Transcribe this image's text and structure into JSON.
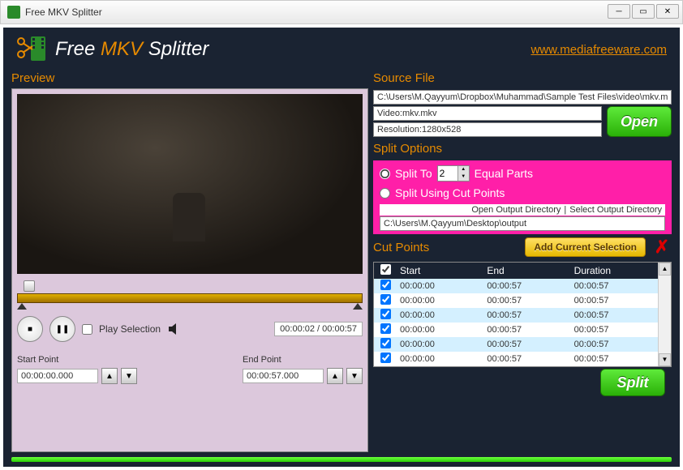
{
  "window": {
    "title": "Free MKV Splitter"
  },
  "header": {
    "logo_pre": "Free ",
    "logo_mid": "MKV",
    "logo_post": " Splitter",
    "link": "www.mediafreeware.com"
  },
  "preview": {
    "title": "Preview",
    "play_selection_label": "Play Selection",
    "time_current": "00:00:02",
    "time_sep": " / ",
    "time_total": "00:00:57",
    "start_label": "Start Point",
    "start_value": "00:00:00.000",
    "end_label": "End Point",
    "end_value": "00:00:57.000"
  },
  "source": {
    "title": "Source File",
    "path": "C:\\Users\\M.Qayyum\\Dropbox\\Muhammad\\Sample Test Files\\video\\mkv.m",
    "video": "Video:mkv.mkv",
    "resolution": "Resolution:1280x528",
    "open_label": "Open"
  },
  "split_options": {
    "title": "Split Options",
    "split_to_label": "Split To",
    "split_to_value": "2",
    "equal_parts_label": "Equal Parts",
    "split_cut_label": "Split Using Cut Points",
    "open_out_dir": "Open Output Directory",
    "sep": "  |  ",
    "select_out_dir": "Select Output Directory",
    "out_path": "C:\\Users\\M.Qayyum\\Desktop\\output"
  },
  "cut": {
    "title": "Cut Points",
    "add_label": "Add Current Selection",
    "cols": {
      "start": "Start",
      "end": "End",
      "duration": "Duration"
    },
    "rows": [
      {
        "start": "00:00:00",
        "end": "00:00:57",
        "duration": "00:00:57"
      },
      {
        "start": "00:00:00",
        "end": "00:00:57",
        "duration": "00:00:57"
      },
      {
        "start": "00:00:00",
        "end": "00:00:57",
        "duration": "00:00:57"
      },
      {
        "start": "00:00:00",
        "end": "00:00:57",
        "duration": "00:00:57"
      },
      {
        "start": "00:00:00",
        "end": "00:00:57",
        "duration": "00:00:57"
      },
      {
        "start": "00:00:00",
        "end": "00:00:57",
        "duration": "00:00:57"
      }
    ]
  },
  "split_button": "Split"
}
